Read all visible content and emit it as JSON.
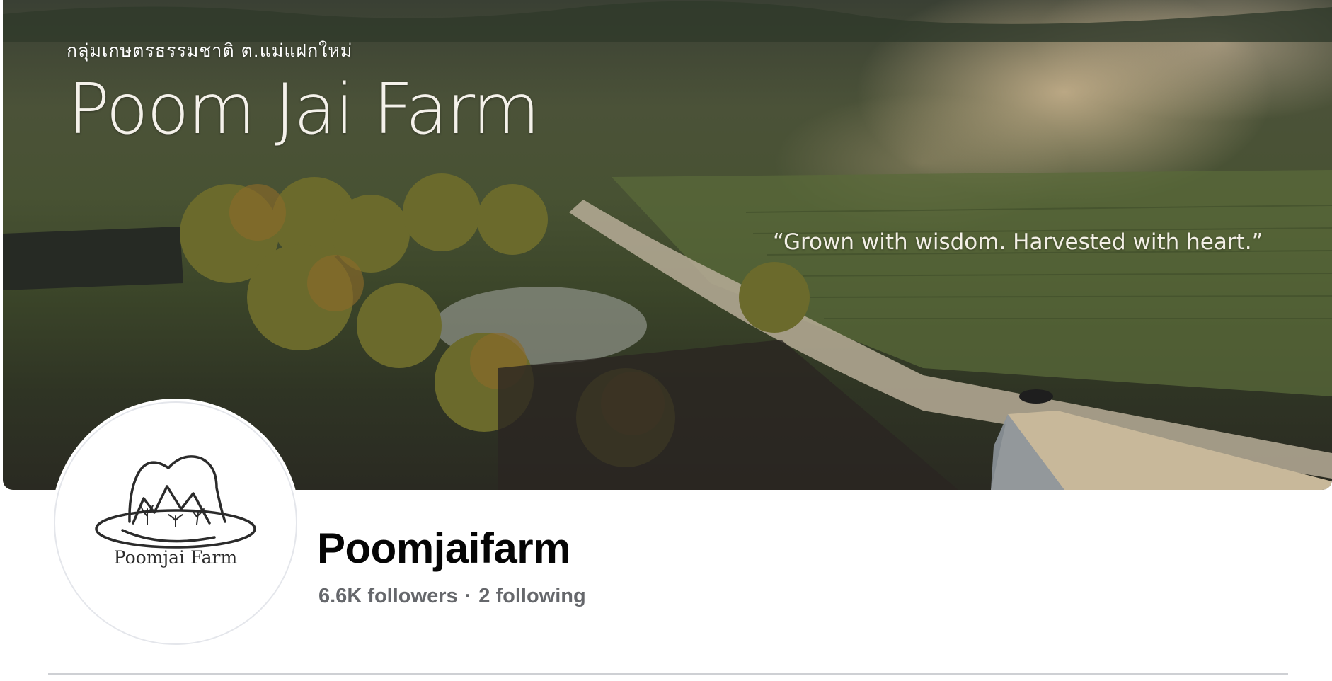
{
  "cover": {
    "thai_subtitle": "กลุ่มเกษตรธรรมชาติ ต.แม่แฝกใหม่",
    "farm_title": "Poom Jai Farm",
    "tagline": "“Grown with wisdom. Harvested with heart.”"
  },
  "avatar": {
    "logo_text": "Poomjai Farm"
  },
  "profile": {
    "name": "Poomjaifarm",
    "followers": "6.6K followers",
    "separator": "·",
    "following": "2 following"
  }
}
